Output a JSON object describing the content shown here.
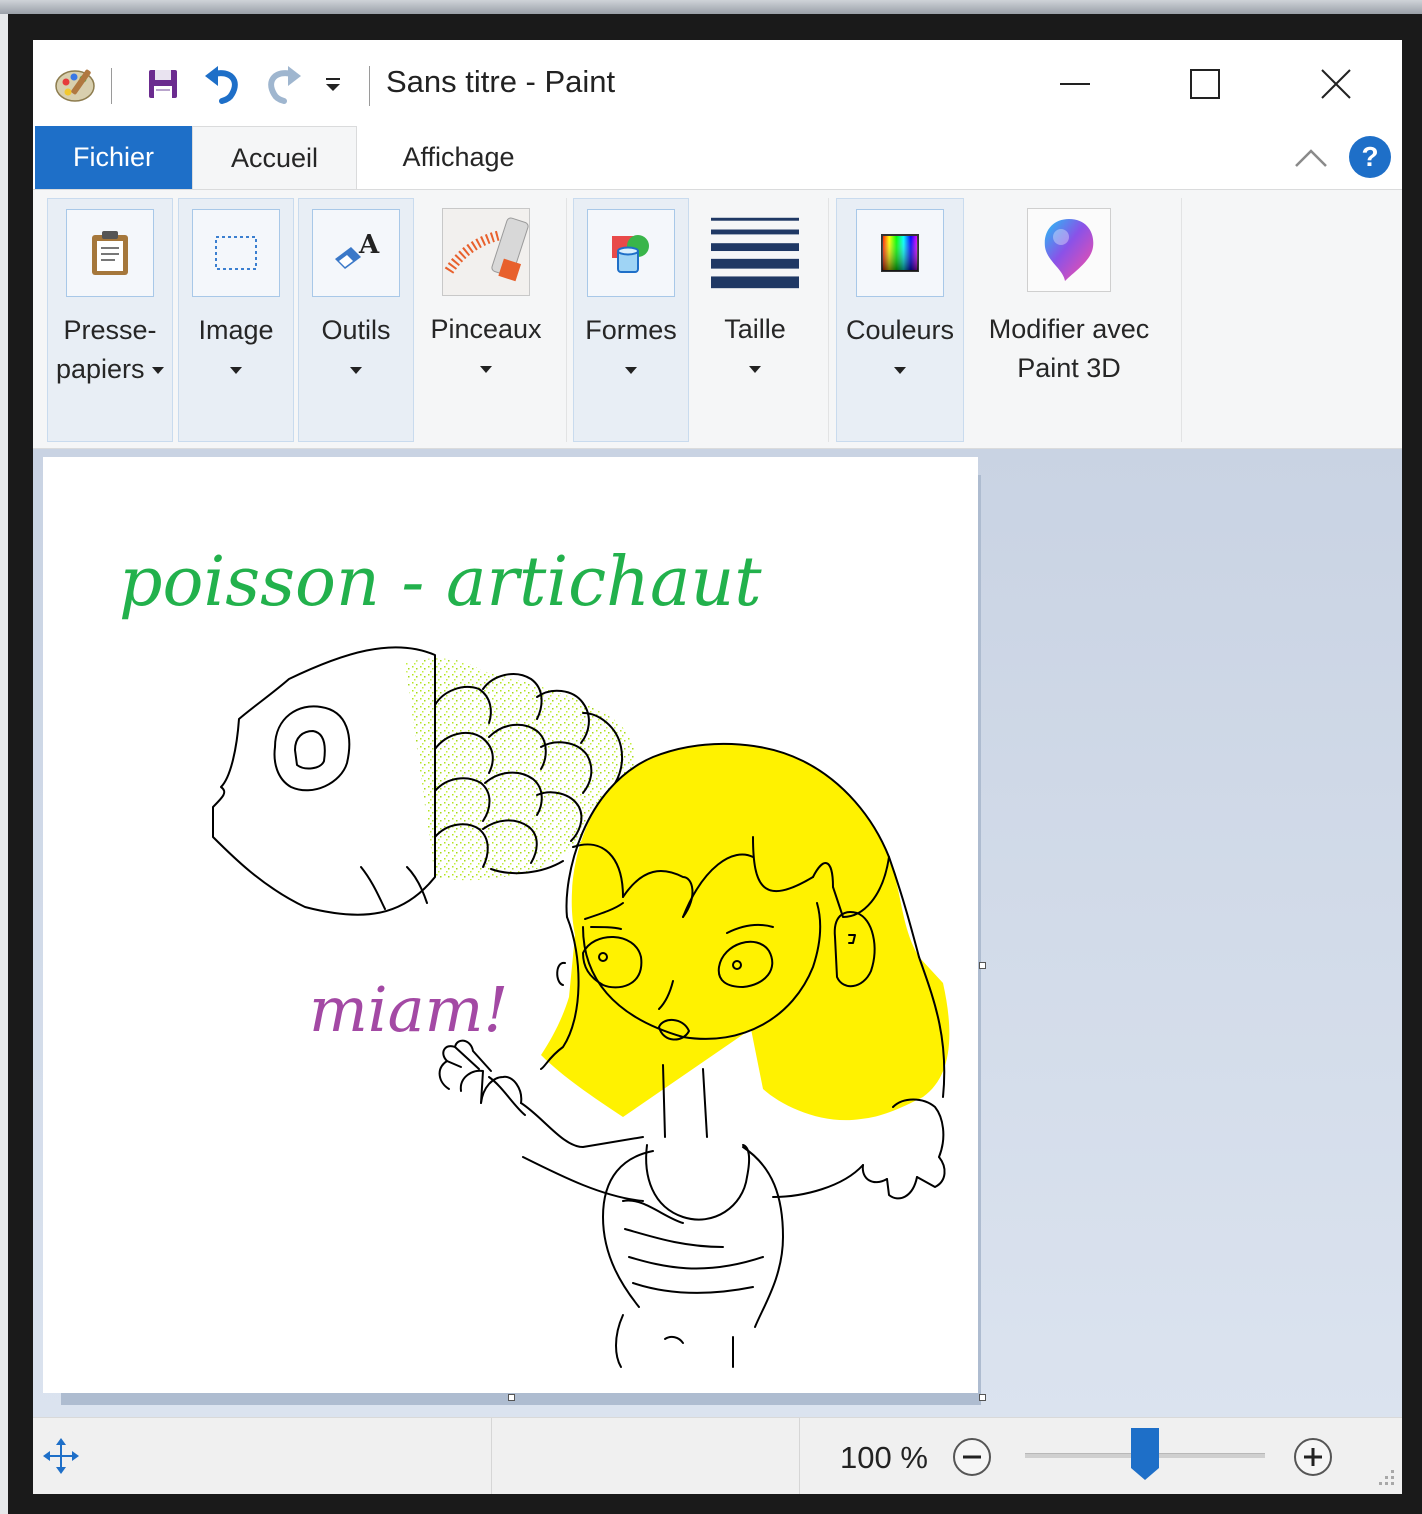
{
  "window": {
    "title": "Sans titre - Paint",
    "quick_access": [
      "paint-app-icon",
      "save-icon",
      "undo-icon",
      "redo-icon",
      "customize-dropdown-icon"
    ],
    "controls": [
      "minimize-icon",
      "maximize-icon",
      "close-icon"
    ]
  },
  "tabs": {
    "file": "Fichier",
    "home": "Accueil",
    "view": "Affichage",
    "collapse_icon": "chevron-up-icon",
    "help_label": "?"
  },
  "ribbon": {
    "clipboard": {
      "line1": "Presse-",
      "line2": "papiers",
      "icon": "clipboard-icon"
    },
    "image": {
      "label": "Image",
      "icon": "select-icon"
    },
    "tools": {
      "label": "Outils",
      "icon": "tools-icon"
    },
    "brushes": {
      "label": "Pinceaux",
      "icon": "brush-icon"
    },
    "shapes": {
      "label": "Formes",
      "icon": "shapes-icon"
    },
    "size": {
      "label": "Taille",
      "icon": "line-size-icon"
    },
    "colors": {
      "label": "Couleurs",
      "icon": "color-palette-icon"
    },
    "paint3d": {
      "line1": "Modifier avec",
      "line2": "Paint 3D",
      "icon": "paint3d-icon"
    }
  },
  "canvas": {
    "text_top": "poisson - artichaut",
    "text_mid": "miam!",
    "colors": {
      "text_top": "#22b14c",
      "text_mid": "#a349a4",
      "hair": "#fff200",
      "scales": "#b5e61d",
      "outline": "#000000"
    }
  },
  "statusbar": {
    "move_icon": "move-cursor-icon",
    "zoom_label": "100 %",
    "zoom_fraction": 0.5,
    "zoom_out_icon": "zoom-out-icon",
    "zoom_in_icon": "zoom-in-icon",
    "grip_icon": "resize-grip-icon"
  },
  "accent": "#1e6fc8"
}
